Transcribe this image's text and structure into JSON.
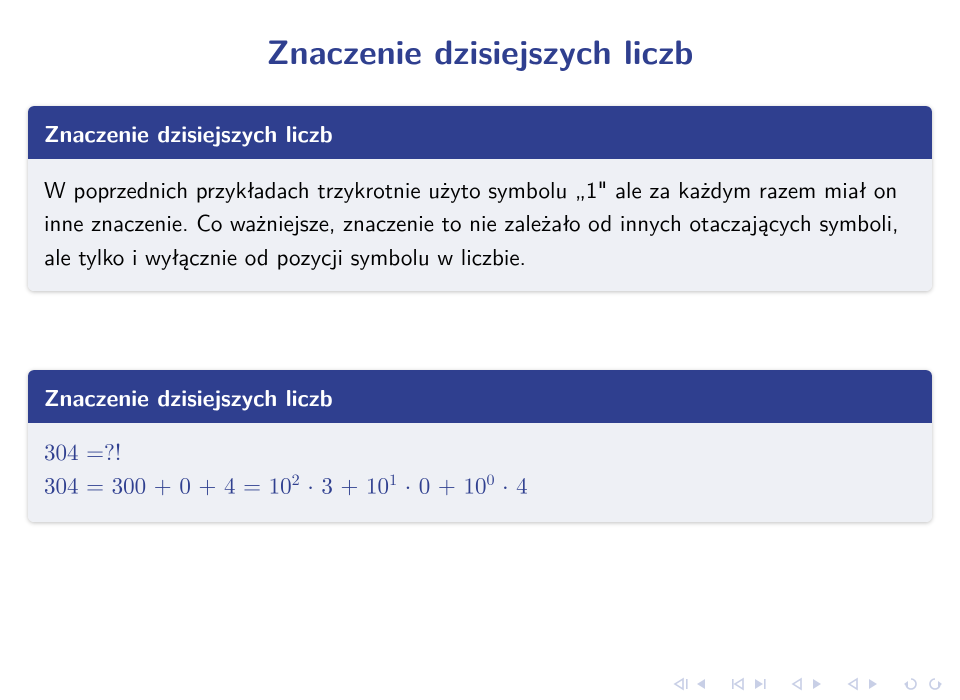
{
  "title": "Znaczenie dzisiejszych liczb",
  "block1": {
    "header": "Znaczenie dzisiejszych liczb",
    "body": "W poprzednich przykładach trzykrotnie użyto symbolu „1\" ale za każdym razem miał on inne znaczenie. Co ważniejsze, znaczenie to nie zależało od innych otaczających symboli, ale tylko i wyłącznie od pozycji symbolu w liczbie."
  },
  "block2": {
    "header": "Znaczenie dzisiejszych liczb",
    "line1": "304 =?!",
    "line2_html": "304 = 300 + 0 + 4 = 10<sup>2</sup> · 3 + 10<sup>1</sup> · 0 + 10<sup>0</sup> · 4"
  },
  "nav": {
    "first_slide": "first-slide",
    "prev_slide": "prev-slide",
    "prev_section": "prev-section",
    "next_section": "next-section",
    "prev_frame": "prev-frame",
    "next_frame": "next-frame",
    "prev_sub": "prev-sub",
    "next_sub": "next-sub",
    "back": "back",
    "search": "search"
  }
}
